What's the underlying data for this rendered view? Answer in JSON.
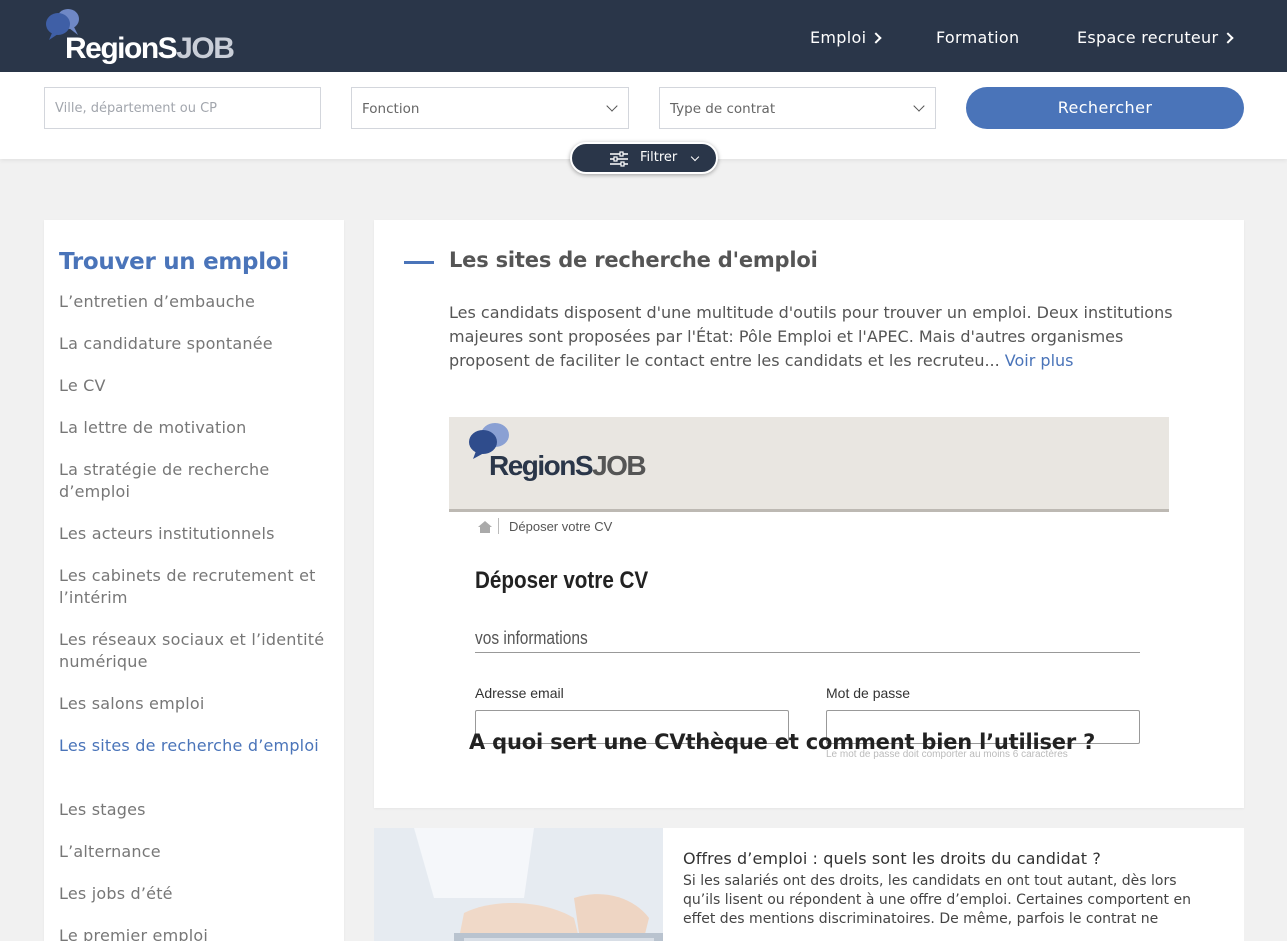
{
  "header": {
    "logo": {
      "regions": "RegionS",
      "job": "JOB"
    },
    "nav": [
      {
        "label": "Emploi",
        "has_chevron": true
      },
      {
        "label": "Formation",
        "has_chevron": false
      },
      {
        "label": "Espace recruteur",
        "has_chevron": true
      }
    ]
  },
  "search": {
    "location_placeholder": "Ville, département ou CP",
    "function_value": "Fonction",
    "contract_value": "Type de contrat",
    "submit_label": "Rechercher",
    "filter_label": "Filtrer"
  },
  "sidebar": {
    "title": "Trouver un emploi",
    "items": [
      {
        "label": "L’entretien d’embauche"
      },
      {
        "label": "La candidature spontanée"
      },
      {
        "label": "Le CV"
      },
      {
        "label": "La lettre de motivation"
      },
      {
        "label": "La stratégie de recherche d’emploi"
      },
      {
        "label": "Les acteurs institutionnels"
      },
      {
        "label": "Les cabinets de recrutement et l’intérim"
      },
      {
        "label": "Les réseaux sociaux et l’identité numérique"
      },
      {
        "label": "Les salons emploi"
      },
      {
        "label": "Les sites de recherche d’emploi",
        "active": true
      },
      {
        "label": "Les stages"
      },
      {
        "label": "L’alternance"
      },
      {
        "label": "Les jobs d’été"
      },
      {
        "label": "Le premier emploi"
      }
    ]
  },
  "main": {
    "title": "Les sites de recherche d'emploi",
    "intro": "Les candidats disposent d'une multitude d'outils pour trouver un emploi. Deux institutions majeures sont proposées par l'État: Pôle Emploi et l'APEC. Mais d'autres organismes proposent de faciliter le contact entre les candidats et les recruteu...",
    "more_link": " Voir plus",
    "hero": {
      "logo": {
        "regions": "RegionS",
        "job": "JOB"
      },
      "breadcrumb": "Déposer votre CV",
      "heading": "Déposer votre CV",
      "section": "vos informations",
      "email_label": "Adresse email",
      "password_label": "Mot de passe",
      "password_hint": "Le mot de passe doit comporter au moins 6 caractères",
      "caption": "A quoi sert une CVthèque et comment bien l’utiliser ?"
    },
    "article": {
      "title": "Offres d’emploi : quels sont les droits du candidat ?",
      "excerpt": "Si les salariés ont des droits, les candidats en ont tout autant, dès lors qu’ils lisent ou répondent à une offre d’emploi. Certaines comportent en effet des mentions discriminatoires. De même, parfois le contrat ne"
    }
  },
  "colors": {
    "navy": "#2a3649",
    "accent": "#4a74b9",
    "background": "#f1f1f1"
  },
  "icons": [
    "chat-bubbles-logo-icon",
    "chevron-right-icon",
    "chevron-down-icon",
    "sliders-icon",
    "home-icon"
  ]
}
